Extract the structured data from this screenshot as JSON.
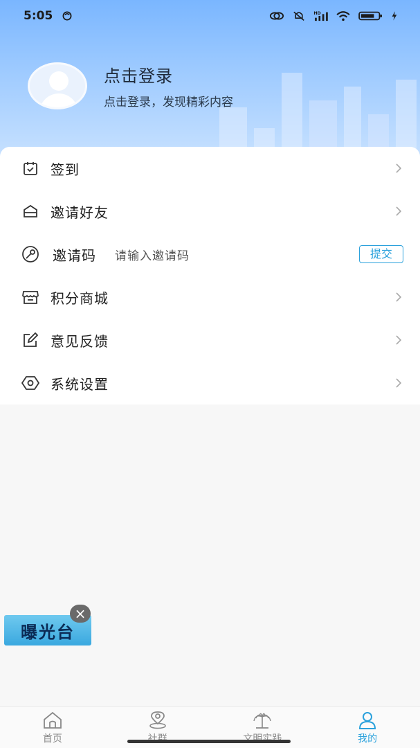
{
  "status": {
    "time": "5:05",
    "network": "HD",
    "battery": "71"
  },
  "profile": {
    "title": "点击登录",
    "subtitle": "点击登录，发现精彩内容"
  },
  "menu": [
    {
      "label": "签到",
      "icon": "checkin-icon"
    },
    {
      "label": "邀请好友",
      "icon": "mail-icon"
    },
    {
      "label": "邀请码",
      "icon": "key-icon",
      "input_placeholder": "请输入邀请码",
      "submit_label": "提交"
    },
    {
      "label": "积分商城",
      "icon": "store-icon"
    },
    {
      "label": "意见反馈",
      "icon": "edit-icon"
    },
    {
      "label": "系统设置",
      "icon": "settings-icon"
    }
  ],
  "expose": {
    "label": "曝光台",
    "close": "×"
  },
  "tabs": [
    {
      "label": "首页",
      "icon": "home-icon",
      "active": false
    },
    {
      "label": "社群",
      "icon": "location-icon",
      "active": false
    },
    {
      "label": "文明实践",
      "icon": "fountain-icon",
      "active": false
    },
    {
      "label": "我的",
      "icon": "user-icon",
      "active": true
    }
  ],
  "colors": {
    "accent": "#2aa1dc",
    "header_top": "#7ab6ff",
    "header_bottom": "#c9e2ff"
  }
}
